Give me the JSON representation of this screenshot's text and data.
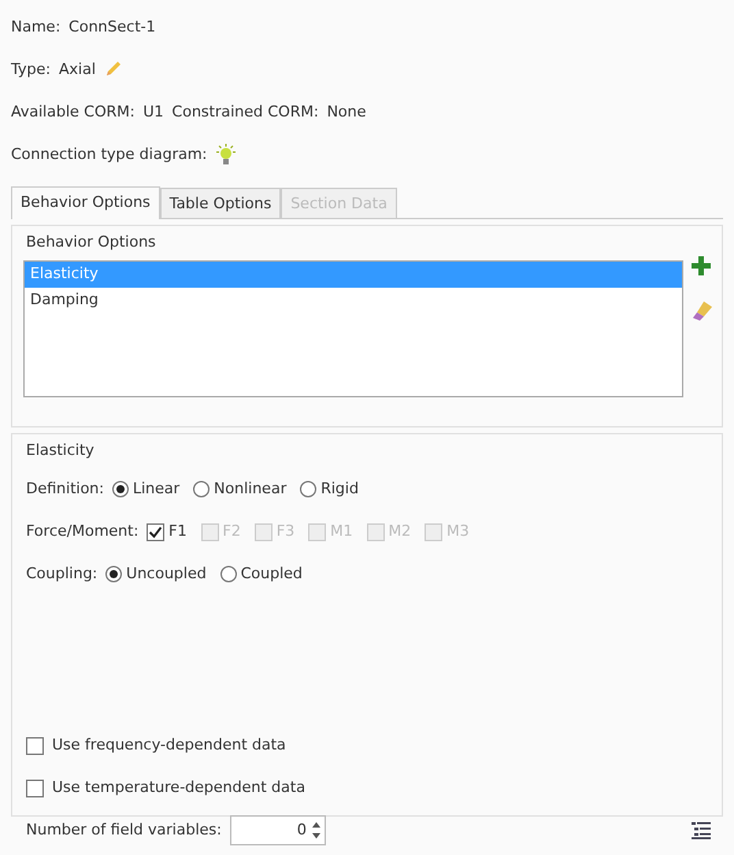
{
  "header": {
    "name_label": "Name:",
    "name": "ConnSect-1",
    "type_label": "Type:",
    "type": "Axial",
    "available_label": "Available CORM:",
    "available": "U1",
    "constrained_label": "Constrained CORM:",
    "constrained": "None",
    "diagram_label": "Connection type diagram:"
  },
  "tabs": [
    {
      "label": "Behavior Options",
      "selected": true,
      "disabled": false
    },
    {
      "label": "Table Options",
      "selected": false,
      "disabled": false
    },
    {
      "label": "Section Data",
      "selected": false,
      "disabled": true
    }
  ],
  "behavior_group": {
    "title": "Behavior Options",
    "items": [
      {
        "label": "Elasticity",
        "selected": true
      },
      {
        "label": "Damping",
        "selected": false
      }
    ]
  },
  "elasticity": {
    "title": "Elasticity",
    "definition": {
      "label": "Definition:",
      "options": [
        {
          "label": "Linear",
          "selected": true
        },
        {
          "label": "Nonlinear",
          "selected": false
        },
        {
          "label": "Rigid",
          "selected": false
        }
      ]
    },
    "force_moment": {
      "label": "Force/Moment:",
      "options": [
        {
          "label": "F1",
          "checked": true,
          "disabled": false
        },
        {
          "label": "F2",
          "checked": false,
          "disabled": true
        },
        {
          "label": "F3",
          "checked": false,
          "disabled": true
        },
        {
          "label": "M1",
          "checked": false,
          "disabled": true
        },
        {
          "label": "M2",
          "checked": false,
          "disabled": true
        },
        {
          "label": "M3",
          "checked": false,
          "disabled": true
        }
      ]
    },
    "coupling": {
      "label": "Coupling:",
      "options": [
        {
          "label": "Uncoupled",
          "selected": true
        },
        {
          "label": "Coupled",
          "selected": false
        }
      ]
    },
    "checkboxes": [
      {
        "label": "Use frequency-dependent data",
        "checked": false
      },
      {
        "label": "Use temperature-dependent data",
        "checked": false
      }
    ],
    "field_variables": {
      "label": "Number of field variables:",
      "value": "0"
    }
  }
}
